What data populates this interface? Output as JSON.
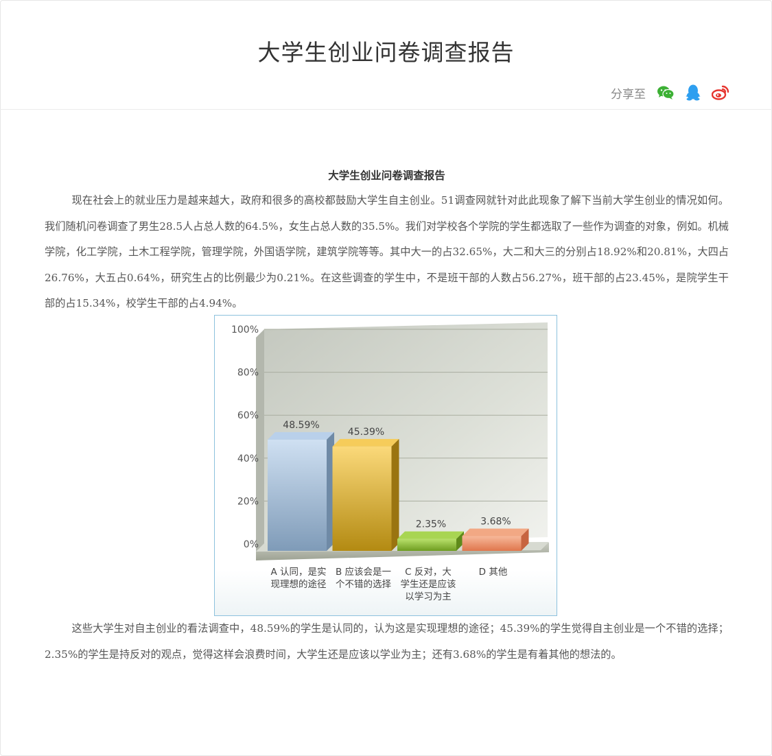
{
  "page": {
    "title": "大学生创业问卷调查报告",
    "share_label": "分享至",
    "share_icons": [
      "wechat-icon",
      "qq-icon",
      "weibo-icon"
    ]
  },
  "article": {
    "heading": "大学生创业问卷调查报告",
    "intro": "现在社会上的就业压力是越来越大，政府和很多的高校都鼓励大学生自主创业。51调查网就针对此此现象了解下当前大学生创业的情况如何。我们随机问卷调查了男生28.5人占总人数的64.5%，女生占总人数的35.5%。我们对学校各个学院的学生都选取了一些作为调查的对象，例如。机械学院，化工学院，土木工程学院，管理学院，外国语学院，建筑学院等等。其中大一的占32.65%，大二和大三的分别占18.92%和20.81%，大四占26.76%，大五占0.64%，研究生占的比例最少为0.21%。在这些调查的学生中，不是班干部的人数占56.27%，班干部的占23.45%，是院学生干部的占15.34%，校学生干部的占4.94%。",
    "conclusion": "这些大学生对自主创业的看法调查中，48.59%的学生是认同的，认为这是实现理想的途径；45.39%的学生觉得自主创业是一个不错的选择；2.35%的学生是持反对的观点，觉得这样会浪费时间，大学生还是应该以学业为主；还有3.68%的学生是有着其他的想法的。"
  },
  "chart_data": {
    "type": "bar",
    "categories": [
      [
        "A 认同，是实",
        "现理想的途径"
      ],
      [
        "B 应该会是一",
        "个不错的选择"
      ],
      [
        "C 反对，大",
        "学生还是应该",
        "以学习为主"
      ],
      [
        "D 其他"
      ]
    ],
    "values": [
      48.59,
      45.39,
      2.35,
      3.68
    ],
    "value_labels": [
      "48.59%",
      "45.39%",
      "2.35%",
      "3.68%"
    ],
    "yticks": [
      "0%",
      "20%",
      "40%",
      "60%",
      "80%",
      "100%"
    ],
    "ylim": [
      0,
      100
    ],
    "grid": true,
    "bar_colors": [
      {
        "front": [
          "#cfe0f2",
          "#7f9bb8"
        ],
        "top": "#b9d0ea",
        "side": "#6f8aa6"
      },
      {
        "front": [
          "#fbd97a",
          "#b38a12"
        ],
        "top": "#f6cc5a",
        "side": "#9a7410"
      },
      {
        "front": [
          "#b8e06a",
          "#6e9d20"
        ],
        "top": "#a8d552",
        "side": "#5f8a1a"
      },
      {
        "front": [
          "#f6b89a",
          "#e0764c"
        ],
        "top": "#f2a884",
        "side": "#c76440"
      }
    ]
  }
}
